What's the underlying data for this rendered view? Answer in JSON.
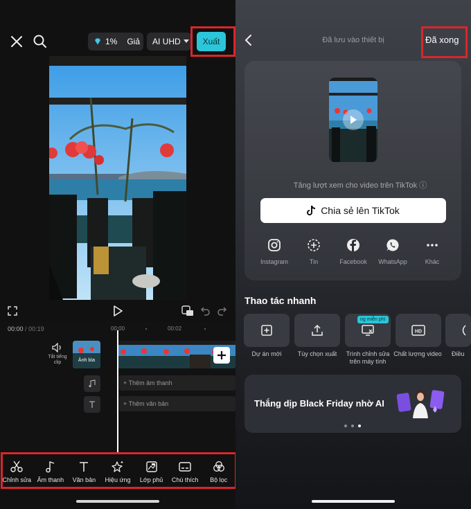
{
  "editor": {
    "pro_percent": "1%",
    "pro_label": "Giả",
    "quality_label": "AI UHD",
    "export_label": "Xuất",
    "time_current": "00:00",
    "time_separator": "/",
    "time_total": "00:19",
    "ruler_ticks": [
      "00:00",
      "00:02"
    ],
    "mute_label": "Tắt tiếng clip",
    "cover_label": "Ảnh bìa",
    "add_audio_label": "+ Thêm âm thanh",
    "add_text_label": "+ Thêm văn bản",
    "tools": [
      {
        "label": "Chỉnh sửa",
        "icon": "scissors-icon"
      },
      {
        "label": "Âm thanh",
        "icon": "music-note-icon"
      },
      {
        "label": "Văn bản",
        "icon": "text-icon"
      },
      {
        "label": "Hiệu ứng",
        "icon": "sparkle-star-icon"
      },
      {
        "label": "Lớp phủ",
        "icon": "overlay-icon"
      },
      {
        "label": "Chú thích",
        "icon": "captions-icon"
      },
      {
        "label": "Bộ lọc",
        "icon": "filter-icon"
      }
    ]
  },
  "export_done": {
    "status_title": "Đã lưu vào thiết bị",
    "done_label": "Đã xong",
    "tiktok_hint": "Tăng lượt xem cho video trên TikTok ⓘ",
    "share_tiktok_label": "Chia sẻ lên TikTok",
    "share_targets": [
      {
        "label": "Instagram",
        "icon": "instagram-icon"
      },
      {
        "label": "Tin",
        "icon": "story-icon"
      },
      {
        "label": "Facebook",
        "icon": "facebook-icon"
      },
      {
        "label": "WhatsApp",
        "icon": "whatsapp-icon"
      },
      {
        "label": "Khác",
        "icon": "more-dots-icon"
      }
    ],
    "quick_actions_title": "Thao tác nhanh",
    "quick_actions": [
      {
        "label": "Dự án mới",
        "icon": "new-project-icon"
      },
      {
        "label": "Tùy chọn xuất",
        "icon": "export-options-icon"
      },
      {
        "label": "Trình chỉnh sửa trên máy tính",
        "icon": "desktop-editor-icon",
        "badge": "ng miễn phí"
      },
      {
        "label": "Chất lượng video",
        "icon": "hd-icon"
      },
      {
        "label": "Điều",
        "icon": "adjust-icon"
      }
    ],
    "promo_text": "Thắng dịp Black Friday nhờ AI"
  },
  "colors": {
    "accent": "#2bc6d8",
    "highlight": "#d9262b"
  }
}
